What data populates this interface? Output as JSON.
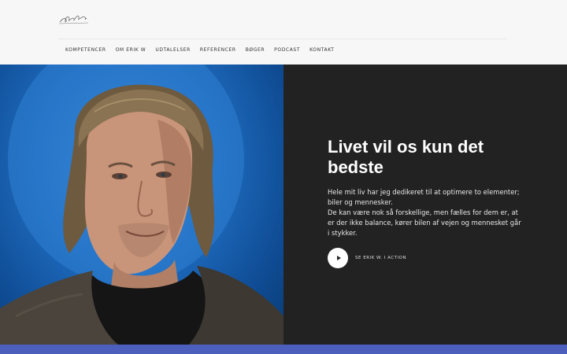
{
  "nav": {
    "items": [
      "KOMPETENCER",
      "OM ERIK W",
      "UDTALELSER",
      "REFERENCER",
      "BØGER",
      "PODCAST",
      "KONTAKT"
    ]
  },
  "hero": {
    "title": "Livet vil os kun det bedste",
    "body": [
      "Hele mit liv har jeg dedikeret til at optimere to elementer; biler og mennesker.",
      "De kan være nok så forskellige, men fælles for dem er, at er der ikke balance, kører bilen af vejen og mennesket går i stykker."
    ],
    "action_label": "SE ERIK W. I ACTION"
  },
  "colors": {
    "panel": "#222222",
    "photo_bg": "#1f6cc0",
    "bottom_bar": "#4d5fbd",
    "header_bg": "#f7f7f7"
  },
  "icons": {
    "logo": "signature-logo-icon",
    "play": "play-icon"
  }
}
